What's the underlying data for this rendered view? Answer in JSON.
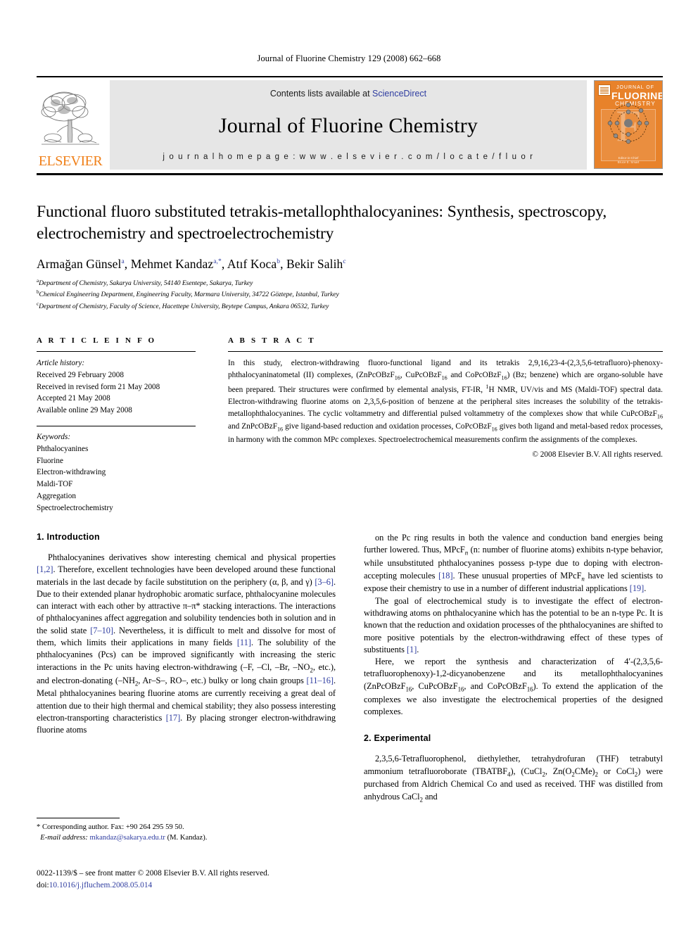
{
  "running_head": "Journal of Fluorine Chemistry 129 (2008) 662–668",
  "masthead": {
    "publisher_name": "ELSEVIER",
    "contents_prefix": "Contents lists available at ",
    "sciencedirect": "ScienceDirect",
    "journal_title": "Journal of Fluorine Chemistry",
    "homepage": "j o u r n a l   h o m e p a g e :   w w w . e l s e v i e r . c o m / l o c a t e / f l u o r",
    "cover": {
      "line1": "JOURNAL OF",
      "line2": "FLUORINE",
      "line3": "CHEMISTRY",
      "foot1": "Editor-in-Chief",
      "foot2": "Bruce E. Smart",
      "bg_color": "#e8822a"
    },
    "link_color": "#2f3da0",
    "band_bg": "#e6e6e6"
  },
  "article": {
    "title": "Functional fluoro substituted tetrakis-metallophthalocyanines: Synthesis, spectroscopy, electrochemistry and spectroelectrochemistry",
    "authors": [
      {
        "name": "Armağan Günsel",
        "marks": "a"
      },
      {
        "name": "Mehmet Kandaz",
        "marks": "a,*"
      },
      {
        "name": "Atıf Koca",
        "marks": "b"
      },
      {
        "name": "Bekir Salih",
        "marks": "c"
      }
    ],
    "affiliations": [
      {
        "mark": "a",
        "text": "Department of Chemistry, Sakarya University, 54140 Esentepe, Sakarya, Turkey"
      },
      {
        "mark": "b",
        "text": "Chemical Engineering Department, Engineering Faculty, Marmara University, 34722 Göztepe, Istanbul, Turkey"
      },
      {
        "mark": "c",
        "text": "Department of Chemistry, Faculty of Science, Hacettepe University, Beytepe Campus, Ankara 06532, Turkey"
      }
    ]
  },
  "article_info": {
    "heading": "A R T I C L E  I N F O",
    "history_label": "Article history:",
    "history": [
      "Received 29 February 2008",
      "Received in revised form 21 May 2008",
      "Accepted 21 May 2008",
      "Available online 29 May 2008"
    ],
    "keywords_label": "Keywords:",
    "keywords": [
      "Phthalocyanines",
      "Fluorine",
      "Electron-withdrawing",
      "Maldi-TOF",
      "Aggregation",
      "Spectroelectrochemistry"
    ]
  },
  "abstract": {
    "heading": "A B S T R A C T",
    "paragraph_html": "In this study, electron-withdrawing fluoro-functional ligand and its tetrakis 2,9,16,23-4-(2,3,5,6-tetrafluoro)-phenoxy-phthalocyaninatometal (II) complexes, (ZnPcOBzF<sub>16</sub>, CuPcOBzF<sub>16</sub> and CoPcOBzF<sub>16</sub>) (Bz; benzene) which are organo-soluble have been prepared. Their structures were confirmed by elemental analysis, FT-IR, <sup class=\"n\">1</sup>H NMR, UV/vis and MS (Maldi-TOF) spectral data. Electron-withdrawing fluorine atoms on 2,3,5,6-position of benzene at the peripheral sites increases the solubility of the tetrakis-metallophthalocyanines. The cyclic voltammetry and differential pulsed voltammetry of the complexes show that while CuPcOBzF<sub>16</sub> and ZnPcOBzF<sub>16</sub> give ligand-based reduction and oxidation processes, CoPcOBzF<sub>16</sub> gives both ligand and metal-based redox processes, in harmony with the common MPc complexes. Spectroelectrochemical measurements confirm the assignments of the complexes.",
    "copyright": "© 2008 Elsevier B.V. All rights reserved."
  },
  "body": {
    "intro_heading": "1. Introduction",
    "intro_p1_html": "Phthalocyanines derivatives show interesting chemical and physical properties <span class=\"ref\">[1,2]</span>. Therefore, excellent technologies have been developed around these functional materials in the last decade by facile substitution on the periphery (α, β, and γ) <span class=\"ref\">[3–6]</span>. Due to their extended planar hydrophobic aromatic surface, phthalocyanine molecules can interact with each other by attractive π–π* stacking interactions. The interactions of phthalocyanines affect aggregation and solubility tendencies both in solution and in the solid state <span class=\"ref\">[7–10]</span>. Nevertheless, it is difficult to melt and dissolve for most of them, which limits their applications in many fields <span class=\"ref\">[11]</span>. The solubility of the phthalocyanines (Pcs) can be improved significantly with increasing the steric interactions in the Pc units having electron-withdrawing (–F, –Cl, –Br, –NO<sub>2</sub>, etc.), and electron-donating (–NH<sub>2</sub>, Ar–S–, RO–, etc.) bulky or long chain groups <span class=\"ref\">[11–16]</span>. Metal phthalocyanines bearing fluorine atoms are currently receiving a great deal of attention due to their high thermal and chemical stability; they also possess interesting electron-transporting characteristics <span class=\"ref\">[17]</span>. By placing stronger electron-withdrawing fluorine atoms",
    "right_p1_html": "on the Pc ring results in both the valence and conduction band energies being further lowered. Thus, MPcF<sub><i>n</i></sub> (n: number of fluorine atoms) exhibits n-type behavior, while unsubstituted phthalocyanines possess p-type due to doping with electron-accepting molecules <span class=\"ref\">[18]</span>. These unusual properties of MPcF<sub><i>n</i></sub> have led scientists to expose their chemistry to use in a number of different industrial applications <span class=\"ref\">[19]</span>.",
    "right_p2_html": "The goal of electrochemical study is to investigate the effect of electron-withdrawing atoms on phthalocyanine which has the potential to be an n-type Pc. It is known that the reduction and oxidation processes of the phthalocyanines are shifted to more positive potentials by the electron-withdrawing effect of these types of substituents <span class=\"ref\">[1]</span>.",
    "right_p3_html": "Here, we report the synthesis and characterization of 4′-(2,3,5,6-tetrafluorophenoxy)-1,2-dicyanobenzene and its metallophthalocyanines (ZnPcOBzF<sub>16</sub>, CuPcOBzF<sub>16</sub>, and CoPcOBzF<sub>16</sub>). To extend the application of the complexes we also investigate the electrochemical properties of the designed complexes.",
    "exp_heading": "2. Experimental",
    "exp_p1_html": "2,3,5,6-Tetrafluorophenol, diethylether, tetrahydrofuran (THF) tetrabutyl ammonium tetrafluoroborate (TBATBF<sub>4</sub>), (CuCl<sub>2</sub>, Zn(O<sub>2</sub>CMe)<sub>2</sub> or CoCl<sub>2</sub>) were purchased from Aldrich Chemical Co and used as received. THF was distilled from anhydrous CaCl<sub>2</sub> and"
  },
  "footnote": {
    "corresponding_html": "<span class=\"star\">*</span> Corresponding author. Fax: +90 264 295 59 50.",
    "email_label": "E-mail address:",
    "email": "mkandaz@sakarya.edu.tr",
    "email_suffix": " (M. Kandaz)."
  },
  "imprint": {
    "line1": "0022-1139/$ – see front matter © 2008 Elsevier B.V. All rights reserved.",
    "doi_label": "doi:",
    "doi": "10.1016/j.jfluchem.2008.05.014"
  }
}
